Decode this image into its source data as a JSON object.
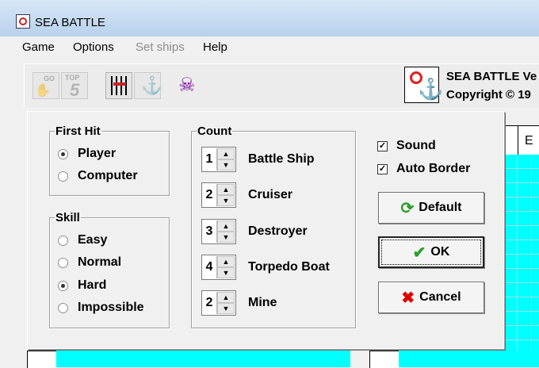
{
  "window": {
    "title": "SEA BATTLE"
  },
  "menu": [
    {
      "label": "Game",
      "disabled": false
    },
    {
      "label": "Options",
      "disabled": false
    },
    {
      "label": "Set ships",
      "disabled": true
    },
    {
      "label": "Help",
      "disabled": false
    }
  ],
  "toolbar": {
    "go_label": "GO",
    "top_label": "TOP",
    "top_number": "5"
  },
  "about": {
    "version_text": "SEA BATTLE Ve",
    "copyright_text": "Copyright © 19"
  },
  "board": {
    "column_header": "E"
  },
  "dialog": {
    "first_hit": {
      "legend": "First Hit",
      "options": [
        "Player",
        "Computer"
      ],
      "selected": "Player"
    },
    "skill": {
      "legend": "Skill",
      "options": [
        "Easy",
        "Normal",
        "Hard",
        "Impossible"
      ],
      "selected": "Hard"
    },
    "count": {
      "legend": "Count",
      "items": [
        {
          "value": "1",
          "name": "Battle Ship"
        },
        {
          "value": "2",
          "name": "Cruiser"
        },
        {
          "value": "3",
          "name": "Destroyer"
        },
        {
          "value": "4",
          "name": "Torpedo Boat"
        },
        {
          "value": "2",
          "name": "Mine"
        }
      ]
    },
    "sound": {
      "label": "Sound",
      "checked": true
    },
    "auto_border": {
      "label": "Auto Border",
      "checked": true
    },
    "buttons": {
      "default_label": "Default",
      "ok_label": "OK",
      "cancel_label": "Cancel"
    }
  },
  "colors": {
    "sea": "#00ffff",
    "ok_icon": "#2a9d2a",
    "cancel_icon": "#e00000"
  }
}
